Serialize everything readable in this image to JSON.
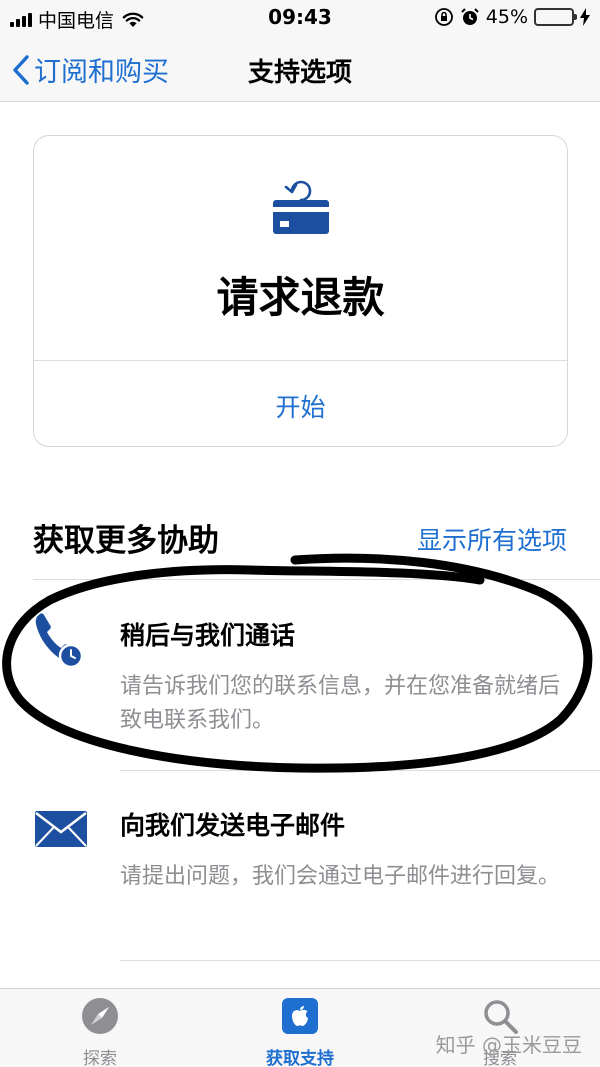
{
  "status_bar": {
    "carrier": "中国电信",
    "time": "09:43",
    "battery_percent": "45%",
    "battery_level": 0.45,
    "icons": [
      "signal-icon",
      "wifi-icon",
      "orientation-lock-icon",
      "alarm-icon",
      "battery-icon",
      "charging-icon"
    ]
  },
  "nav": {
    "back_label": "订阅和购买",
    "title": "支持选项"
  },
  "refund_card": {
    "title": "请求退款",
    "action": "开始",
    "icon": "refund-card-icon"
  },
  "more_help": {
    "title": "获取更多协助",
    "link": "显示所有选项",
    "options": [
      {
        "icon": "phone-clock-icon",
        "title": "稍后与我们通话",
        "description": "请告诉我们您的联系信息，并在您准备就绪后致电联系我们。"
      },
      {
        "icon": "envelope-icon",
        "title": "向我们发送电子邮件",
        "description": "请提出问题，我们会通过电子邮件进行回复。"
      }
    ]
  },
  "tab_bar": {
    "tabs": [
      {
        "label": "探索",
        "icon": "compass-icon"
      },
      {
        "label": "获取支持",
        "icon": "apple-icon",
        "active": true
      },
      {
        "label": "搜索",
        "icon": "search-icon"
      }
    ]
  },
  "watermark": "知乎 @玉米豆豆",
  "colors": {
    "accent": "#1f6fd1",
    "icon_blue": "#1c4fa0",
    "secondary_text": "#8e8e93",
    "battery": "#34c759"
  }
}
